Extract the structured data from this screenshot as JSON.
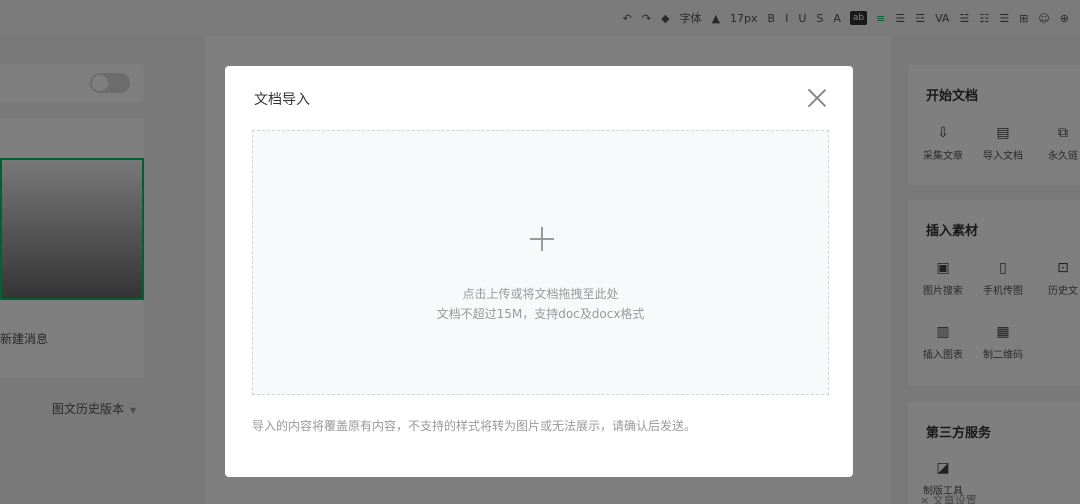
{
  "toolbar": {
    "items": [
      {
        "name": "undo-icon",
        "label": "↶"
      },
      {
        "name": "redo-icon",
        "label": "↷"
      },
      {
        "name": "format-brush-icon",
        "label": "◆"
      },
      {
        "name": "font-family-select",
        "label": "字体"
      },
      {
        "name": "font-color-icon",
        "label": "▲"
      },
      {
        "name": "font-size-select",
        "label": "17px"
      },
      {
        "name": "bold-icon",
        "label": "B"
      },
      {
        "name": "italic-icon",
        "label": "I"
      },
      {
        "name": "underline-icon",
        "label": "U"
      },
      {
        "name": "strikethrough-icon",
        "label": "S"
      },
      {
        "name": "text-color-icon",
        "label": "A"
      },
      {
        "name": "background-color-icon",
        "label": "ab"
      },
      {
        "name": "align-icon",
        "label": "≡"
      },
      {
        "name": "indent-icon",
        "label": "☰"
      },
      {
        "name": "line-spacing-icon",
        "label": "☲"
      },
      {
        "name": "letter-spacing-icon",
        "label": "VA"
      },
      {
        "name": "paragraph-spacing-icon",
        "label": "☱"
      },
      {
        "name": "ordered-list-icon",
        "label": "☷"
      },
      {
        "name": "unordered-list-icon",
        "label": "☰"
      },
      {
        "name": "table-icon",
        "label": "⊞"
      },
      {
        "name": "emoji-icon",
        "label": "☺"
      },
      {
        "name": "more-icon",
        "label": "⊕"
      }
    ]
  },
  "left": {
    "msg_text": "新建消息",
    "history_label": "图文历史版本"
  },
  "right": {
    "sections": [
      {
        "title": "开始文档",
        "items": [
          {
            "icon": "⇩",
            "label": "采集文章"
          },
          {
            "icon": "▤",
            "label": "导入文档"
          },
          {
            "icon": "⧉",
            "label": "永久链"
          }
        ]
      },
      {
        "title": "插入素材",
        "rows": [
          [
            {
              "icon": "▣",
              "label": "图片搜索"
            },
            {
              "icon": "▯",
              "label": "手机传图"
            },
            {
              "icon": "⊡",
              "label": "历史文"
            }
          ],
          [
            {
              "icon": "▥",
              "label": "插入图表"
            },
            {
              "icon": "▦",
              "label": "制二维码"
            }
          ]
        ]
      },
      {
        "title": "第三方服务",
        "items": [
          {
            "icon": "◪",
            "label": "制版工具"
          }
        ]
      }
    ],
    "footer": "× 文章设置"
  },
  "dialog": {
    "title": "文档导入",
    "drop_hint_1": "点击上传或将文档拖拽至此处",
    "drop_hint_2": "文档不超过15M，支持doc及docx格式",
    "note": "导入的内容将覆盖原有内容，不支持的样式将转为图片或无法展示，请确认后发送。"
  }
}
